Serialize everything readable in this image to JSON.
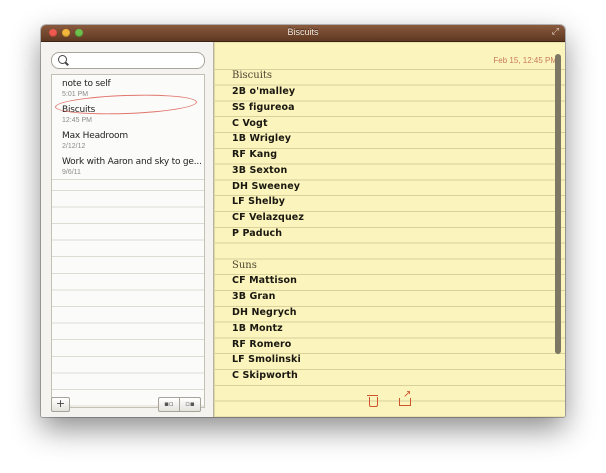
{
  "window": {
    "title": "Biscuits"
  },
  "sidebar": {
    "notes": [
      {
        "title": "note to self",
        "date": "5:01 PM"
      },
      {
        "title": "Biscuits",
        "date": "12:45 PM"
      },
      {
        "title": "Max Headroom",
        "date": "2/12/12"
      },
      {
        "title": "Work with Aaron and sky to ge...",
        "date": "9/6/11"
      }
    ],
    "add_label": "+"
  },
  "note": {
    "date": "Feb 15, 12:45 PM",
    "sections": [
      {
        "heading": "Biscuits",
        "players": [
          "2B o'malley",
          "SS figureoa",
          "C Vogt",
          "1B Wrigley",
          "RF Kang",
          "3B Sexton",
          "DH Sweeney",
          "LF Shelby",
          "CF Velazquez",
          "P Paduch"
        ]
      },
      {
        "heading": "Suns",
        "players": [
          "CF Mattison",
          "3B Gran",
          "DH Negrych",
          "1B Montz",
          "RF Romero",
          "LF Smolinski",
          "C Skipworth"
        ]
      }
    ]
  },
  "icons": {
    "search": "search-icon",
    "trash": "trash-icon",
    "share": "share-icon"
  },
  "colors": {
    "titlebar": "#6e4530",
    "paper": "#fbf4bd",
    "accent": "#d0542a"
  }
}
